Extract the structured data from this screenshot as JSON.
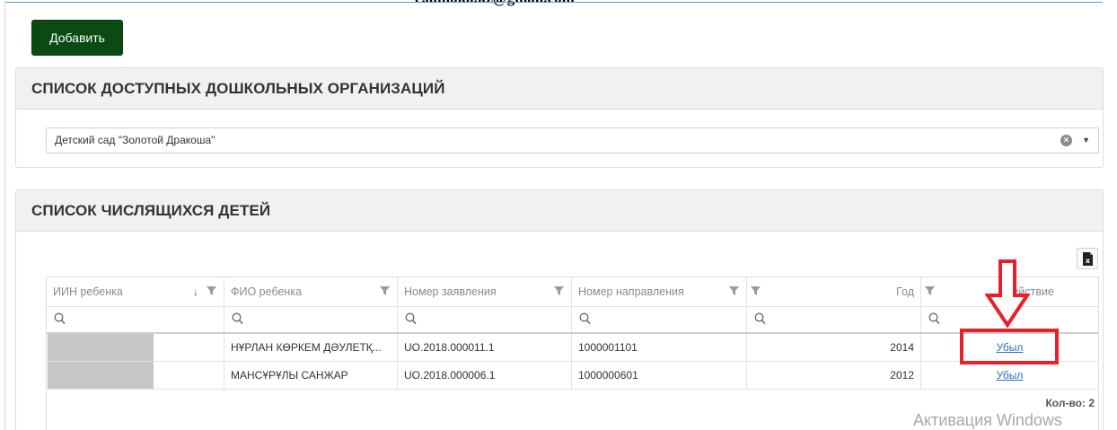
{
  "header": {
    "email_fragment": "e.almoka.kz@gmail.com"
  },
  "toolbar": {
    "add_label": "Добавить"
  },
  "organizations": {
    "title": "СПИСОК ДОСТУПНЫХ ДОШКОЛЬНЫХ ОРГАНИЗАЦИЙ",
    "selected": "Детский сад \"Золотой Дракоша\"",
    "clear_glyph": "×",
    "caret_glyph": "▼"
  },
  "children": {
    "title": "СПИСОК ЧИСЛЯЩИХСЯ ДЕТЕЙ",
    "columns": [
      "ИИН ребенка",
      "ФИО ребенка",
      "Номер заявления",
      "Номер направления",
      "Год",
      "Действие"
    ],
    "sort_glyph": "↓",
    "rows": [
      {
        "iin": "",
        "name": "НҰРЛАН КӨРКЕМ ДӘУЛЕТҚ...",
        "application": "UO.2018.000011.1",
        "direction": "1000001101",
        "year": "2014",
        "action": "Убыл"
      },
      {
        "iin": "",
        "name": "МАНСҰРҰЛЫ САНЖАР",
        "application": "UO.2018.000006.1",
        "direction": "1000000601",
        "year": "2012",
        "action": "Убыл"
      }
    ],
    "count_label": "Кол-во: 2"
  },
  "os": {
    "watermark": "Активация Windows"
  },
  "annotations": {
    "highlight_color": "#e8202a"
  },
  "colors": {
    "add_button": "#0b4a12",
    "link": "#2a6cc6",
    "header_bg": "#f1f1f1"
  },
  "icons": [
    "filter-icon",
    "search-icon",
    "export-excel-icon",
    "clear-icon",
    "caret-down-icon",
    "sort-down-icon",
    "arrow-down-annotation"
  ]
}
